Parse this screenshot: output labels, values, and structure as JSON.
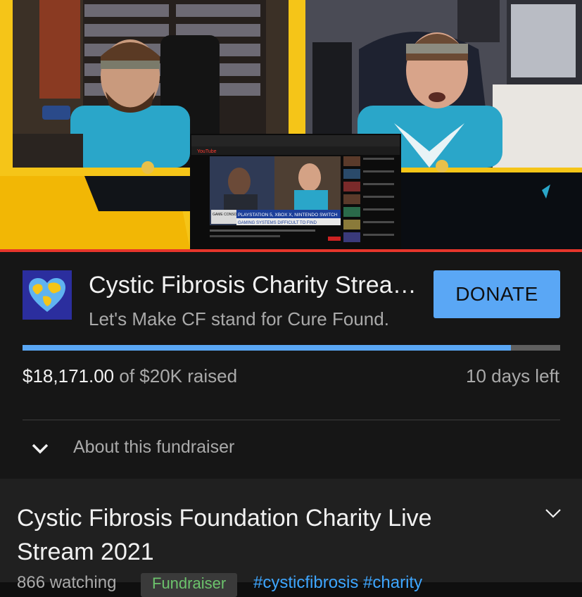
{
  "video": {
    "inner_screen": {
      "chyron_left": "GAME CONSOLE SHORTAGE",
      "chyron_headline": "PLAYSTATION 5, XBOX X, NINTENDO SWITCH",
      "chyron_sub": "GAMING SYSTEMS DIFFICULT TO FIND",
      "youtube_logo": "YouTube"
    },
    "colors": {
      "frame_yellow": "#f5c518",
      "player_progress": "#e6362b"
    }
  },
  "fundraiser": {
    "title": "Cystic Fibrosis Charity Strea…",
    "subtitle": "Let's Make CF stand for Cure Found.",
    "donate_label": "DONATE",
    "progress_fraction": 0.908,
    "raised_amount": "$18,171.00",
    "raised_rest": " of $20K raised",
    "days_left": "10 days left",
    "about_label": "About this fundraiser",
    "logo_icon": "heart-globe-icon",
    "colors": {
      "accent": "#5aa7f5",
      "logo_bg": "#2b2e9e"
    }
  },
  "video_info": {
    "title": "Cystic Fibrosis Foundation Charity Live Stream 2021",
    "watching": "866 watching",
    "chip": "Fundraiser",
    "hashtags": "#cysticfibrosis #charity",
    "expand_icon": "chevron-down-icon"
  }
}
